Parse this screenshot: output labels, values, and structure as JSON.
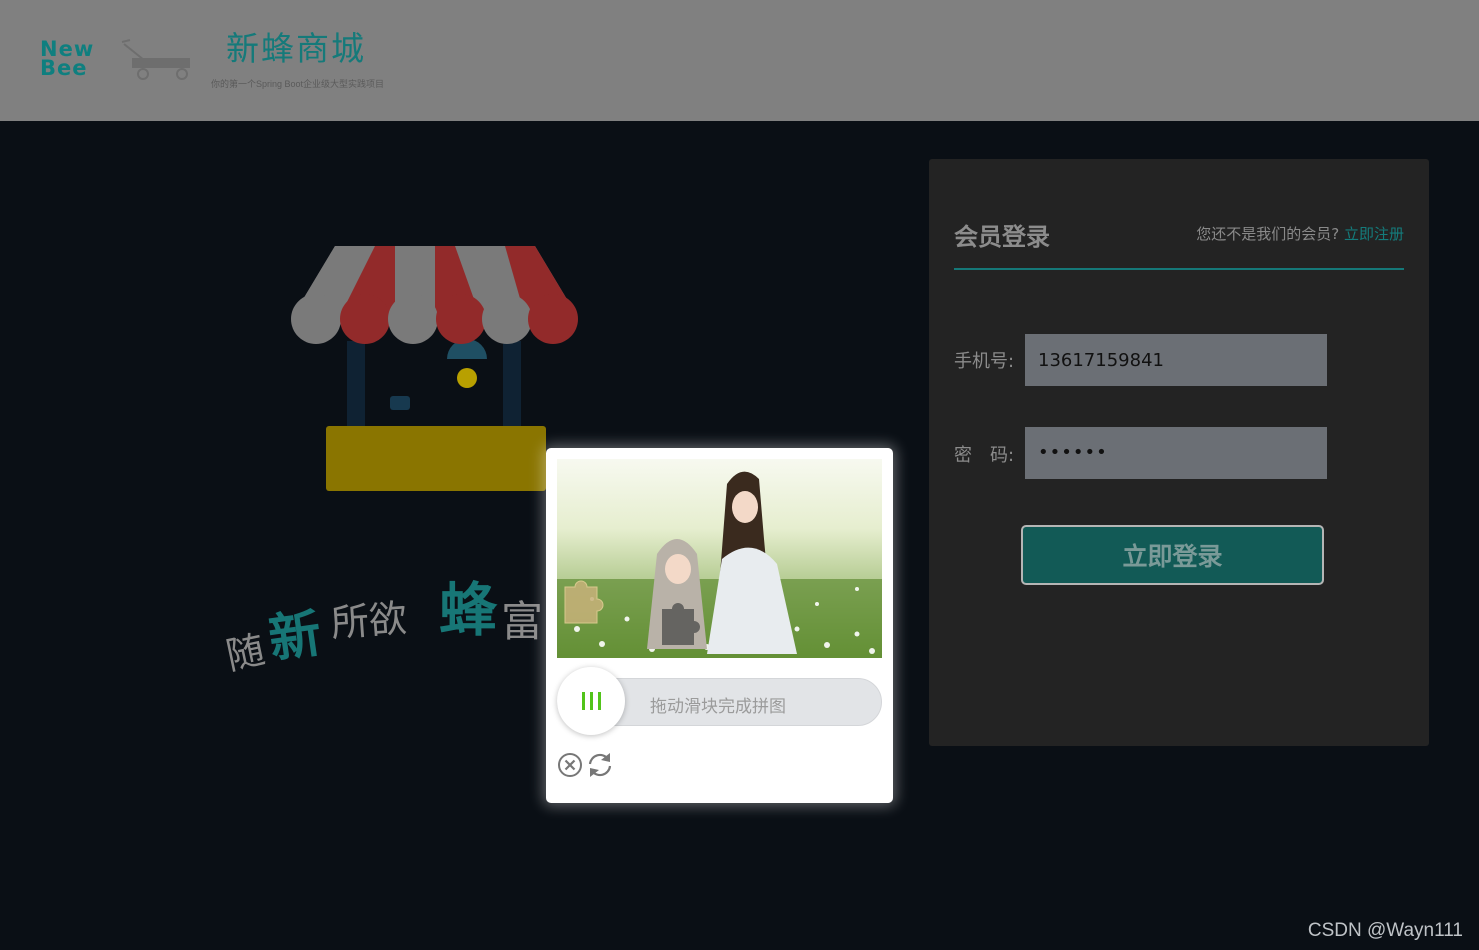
{
  "header": {
    "logo_line1": "New",
    "logo_line2": "Bee",
    "brand_title": "新蜂商城",
    "brand_subtitle": "你的第一个Spring Boot企业级大型实践项目"
  },
  "hero": {
    "slogan_chars": [
      "随",
      "新",
      "所欲",
      "蜂",
      "富"
    ]
  },
  "login": {
    "title": "会员登录",
    "register_prompt": "您还不是我们的会员?",
    "register_link": "立即注册",
    "phone_label": "手机号:",
    "phone_value": "13617159841",
    "password_label": "密　码:",
    "password_masked": "••••••",
    "submit_label": "立即登录"
  },
  "captcha": {
    "slider_hint": "拖动滑块完成拼图",
    "close_icon": "close-circle-icon",
    "refresh_icon": "refresh-icon"
  },
  "colors": {
    "accent": "#157878",
    "header_bg": "#808080",
    "page_bg": "#0a0f15",
    "panel_bg": "#232323",
    "knob_bars": "#52c41a"
  },
  "watermark": "CSDN @Wayn111"
}
